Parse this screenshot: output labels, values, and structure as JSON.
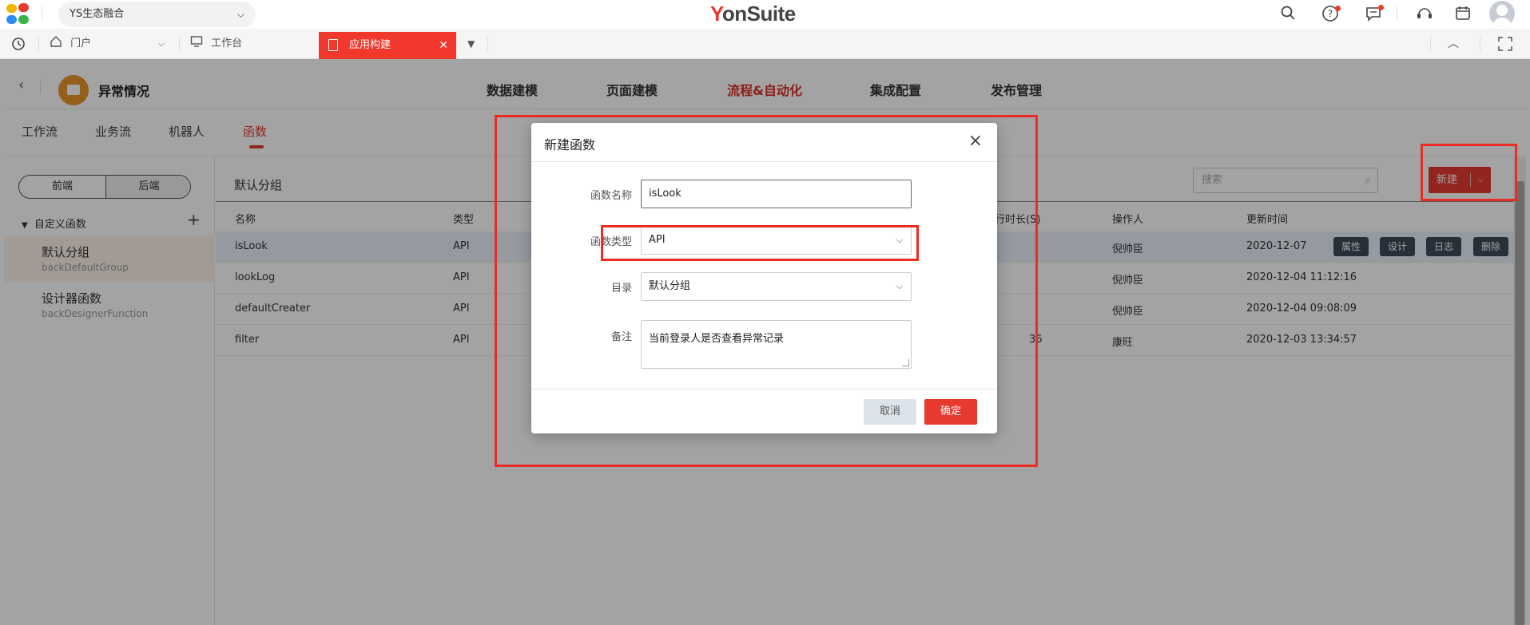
{
  "topbar": {
    "org": "YS生态融合",
    "brand_y": "Y",
    "brand_rest": "onSuite"
  },
  "tabbar": {
    "portal": "门户",
    "workbench": "工作台",
    "active_tab": "应用构建"
  },
  "appbar": {
    "app_name": "异常情况",
    "nav": [
      "数据建模",
      "页面建模",
      "流程&自动化",
      "集成配置",
      "发布管理"
    ],
    "active_nav_index": 2
  },
  "subnav": {
    "items": [
      "工作流",
      "业务流",
      "机器人",
      "函数"
    ],
    "active_index": 3
  },
  "sidebar": {
    "segment": [
      "前端",
      "后端"
    ],
    "tree_head": "自定义函数",
    "groups": [
      {
        "name": "默认分组",
        "code": "backDefaultGroup"
      },
      {
        "name": "设计器函数",
        "code": "backDesignerFunction"
      }
    ]
  },
  "content": {
    "title": "默认分组",
    "search_placeholder": "搜索",
    "new_button": "新建",
    "columns": {
      "name": "名称",
      "type": "类型",
      "duration": "行时长(S)",
      "operator": "操作人",
      "updated": "更新时间"
    },
    "rows": [
      {
        "name": "isLook",
        "type": "API",
        "duration": "",
        "operator": "倪帅臣",
        "updated": "2020-12-07"
      },
      {
        "name": "lookLog",
        "type": "API",
        "duration": "",
        "operator": "倪帅臣",
        "updated": "2020-12-04 11:12:16"
      },
      {
        "name": "defaultCreater",
        "type": "API",
        "duration": "",
        "operator": "倪帅臣",
        "updated": "2020-12-04 09:08:09"
      },
      {
        "name": "filter",
        "type": "API",
        "duration": "36",
        "operator": "康旺",
        "updated": "2020-12-03 13:34:57"
      }
    ],
    "row_actions": [
      "属性",
      "设计",
      "日志",
      "删除"
    ]
  },
  "dialog": {
    "title": "新建函数",
    "name_label": "函数名称",
    "name_value": "isLook",
    "type_label": "函数类型",
    "type_value": "API",
    "dir_label": "目录",
    "dir_value": "默认分组",
    "remark_label": "备注",
    "remark_value": "当前登录人是否查看异常记录",
    "cancel": "取消",
    "ok": "确定"
  },
  "colors": {
    "accent": "#e53a2f",
    "annotation": "#ee2b22",
    "row_action_bg": "#3e4a5a"
  }
}
